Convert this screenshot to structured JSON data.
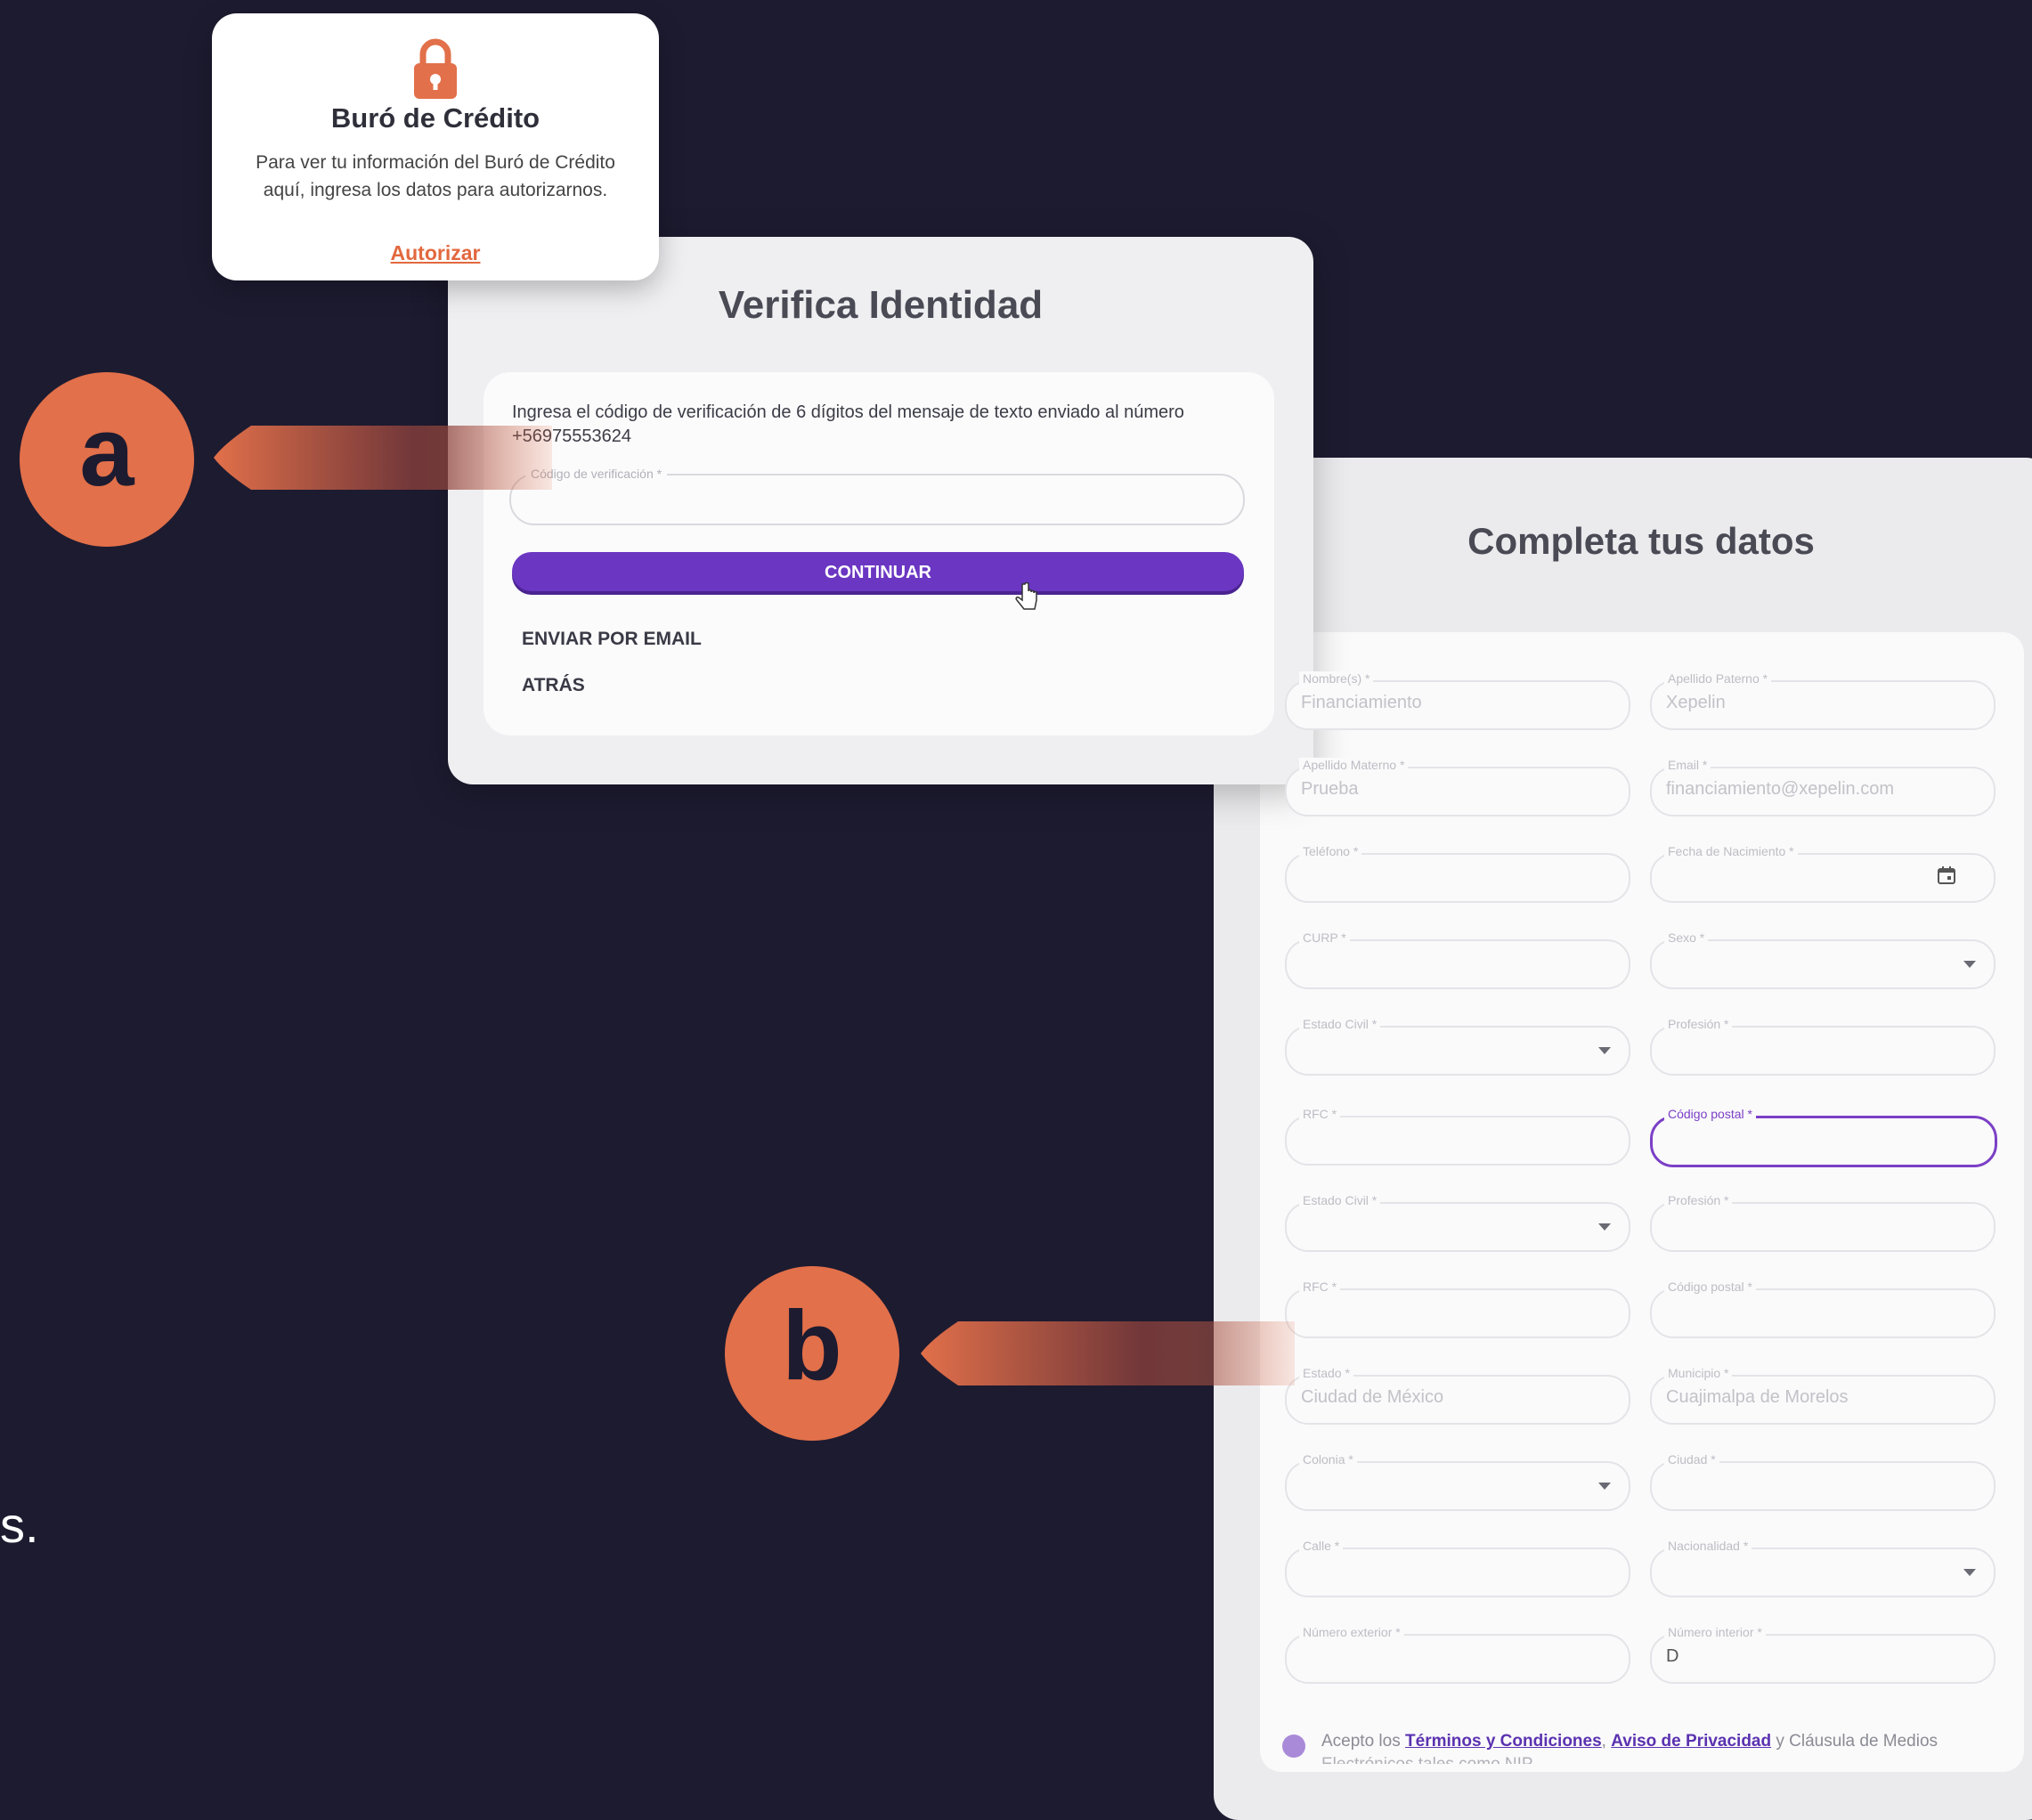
{
  "buro": {
    "title": "Buró de Crédito",
    "description": "Para ver tu información del Buró de Crédito aquí, ingresa los datos para autorizarnos.",
    "link": "Autorizar",
    "lock_icon": "lock-icon"
  },
  "verifica": {
    "title": "Verifica Identidad",
    "instructions": "Ingresa el código de verificación de 6 dígitos del mensaje de texto enviado al número +56975553624",
    "code_label": "Código de verificación *",
    "continue_button": "CONTINUAR",
    "email_button": "ENVIAR POR EMAIL",
    "back_button": "ATRÁS"
  },
  "completa": {
    "title": "Completa tus datos",
    "fields": [
      {
        "label": "Nombre(s) *",
        "value": "Financiamiento"
      },
      {
        "label": "Apellido Paterno *",
        "value": "Xepelin"
      },
      {
        "label": "Apellido Materno *",
        "value": "Prueba"
      },
      {
        "label": "Email *",
        "value": "financiamiento@xepelin.com"
      },
      {
        "label": "Teléfono *",
        "value": ""
      },
      {
        "label": "Fecha de Nacimiento *",
        "value": ""
      },
      {
        "label": "CURP *",
        "value": ""
      },
      {
        "label": "Sexo *",
        "value": ""
      },
      {
        "label": "Estado Civil *",
        "value": ""
      },
      {
        "label": "Profesión *",
        "value": ""
      },
      {
        "label": "RFC *",
        "value": ""
      },
      {
        "label": "Código postal *",
        "value": ""
      },
      {
        "label": "Estado Civil *",
        "value": ""
      },
      {
        "label": "Profesión *",
        "value": ""
      },
      {
        "label": "RFC *",
        "value": ""
      },
      {
        "label": "Código postal *",
        "value": ""
      },
      {
        "label": "Estado *",
        "value": "Ciudad de México"
      },
      {
        "label": "Municipio *",
        "value": "Cuajimalpa de Morelos"
      },
      {
        "label": "Colonia *",
        "value": ""
      },
      {
        "label": "Ciudad *",
        "value": ""
      },
      {
        "label": "Calle *",
        "value": ""
      },
      {
        "label": "Nacionalidad *",
        "value": ""
      },
      {
        "label": "Número exterior *",
        "value": ""
      },
      {
        "label": "Número interior *",
        "value": "D"
      }
    ],
    "terms_prefix": "Acepto los",
    "terms_link": "Términos y Condiciones",
    "privacy_link": "Aviso de Privacidad",
    "terms_suffix": "y Cláusula de Medios",
    "terms_cut": "Electrónicos tales como NIP"
  },
  "badges": {
    "a": "a",
    "b": "b"
  },
  "stray_text": "s.",
  "colors": {
    "accent": "#6a36c2",
    "orange": "#e2704a",
    "background": "#1d1b30"
  }
}
